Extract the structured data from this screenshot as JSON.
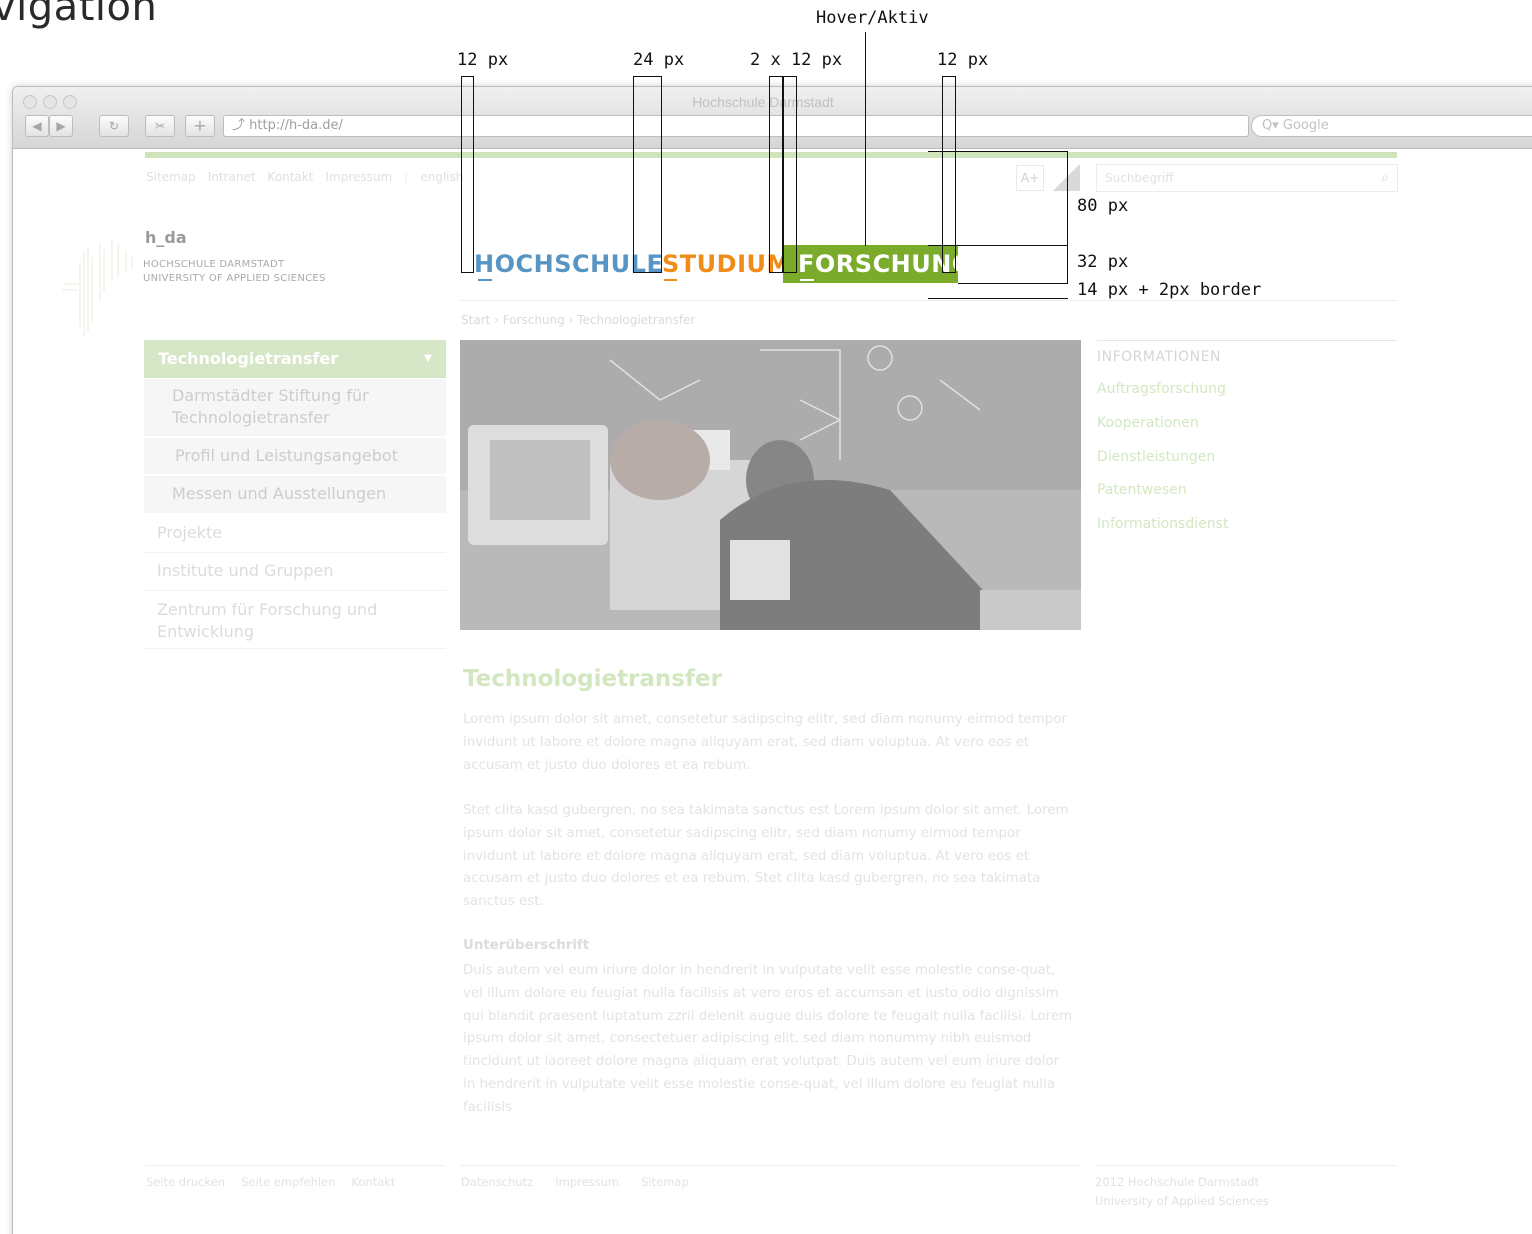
{
  "heading": "vigation",
  "annotations": {
    "hover": "Hover/Aktiv",
    "w12a": "12 px",
    "w24": "24 px",
    "w2x12": "2 x 12 px",
    "w12b": "12 px",
    "h80": "80 px",
    "h32": "32 px",
    "h14": "14 px + 2px border"
  },
  "browser": {
    "title": "Hochschule Darmstadt",
    "url": "http://h-da.de/",
    "search_placeholder": "Google",
    "back_icon": "back-arrow-icon",
    "forward_icon": "forward-arrow-icon",
    "reload_icon": "reload-icon",
    "add_icon": "plus-icon"
  },
  "meta_nav": [
    "Sitemap",
    "Intranet",
    "Kontakt",
    "Impressum",
    "english"
  ],
  "font_size_button": "A+",
  "search": {
    "placeholder": "Suchbegriff"
  },
  "logo": {
    "name": "h_da",
    "line1": "HOCHSCHULE DARMSTADT",
    "line2": "UNIVERSITY OF APPLIED SCIENCES"
  },
  "main_nav": {
    "hochschule": "HOCHSCHULE",
    "studium": "STUDIUM",
    "forschung": "FORSCHUNG",
    "colors": {
      "hochschule": "#5795c5",
      "studium": "#ef8c1a",
      "forschung": "#7bab2b"
    }
  },
  "breadcrumb": "Start › Forschung › Technologietransfer",
  "sidebar": {
    "active": "Technologietransfer",
    "sub": [
      "Darmstädter Stiftung für Technologietransfer",
      "Profil und Leistungsangebot",
      "Messen und Ausstellungen"
    ],
    "items": [
      "Projekte",
      "Institute und Gruppen",
      "Zentrum für Forschung und Entwicklung"
    ]
  },
  "info": {
    "heading": "INFORMATIONEN",
    "links": [
      "Auftragsforschung",
      "Kooperationen",
      "Dienstleistungen",
      "Patentwesen",
      "Informationsdienst"
    ]
  },
  "article": {
    "title": "Technologietransfer",
    "p1": "Lorem ipsum dolor sit amet, consetetur sadipscing elitr, sed diam nonumy eirmod tempor invidunt ut labore et dolore magna aliquyam erat, sed diam voluptua. At vero eos et accusam et justo duo dolores et ea rebum.",
    "p2": "Stet clita kasd gubergren, no sea takimata sanctus est Lorem ipsum dolor sit amet. Lorem ipsum dolor sit amet, consetetur sadipscing elitr, sed diam nonumy eirmod tempor invidunt ut labore et dolore magna aliquyam erat, sed diam voluptua. At vero eos et accusam et justo duo dolores et ea rebum. Stet clita kasd gubergren, no sea takimata sanctus est.",
    "subheading": "Unterüberschrift",
    "p3": "Duis autem vel eum iriure dolor in hendrerit in vulputate velit esse molestie conse-quat, vel illum dolore eu feugiat nulla facilisis at vero eros et accumsan et iusto odio dignissim qui blandit praesent luptatum zzril delenit augue duis dolore te feugait nulla facilisi. Lorem ipsum dolor sit amet, consectetuer adipiscing elit, sed diam nonummy nibh euismod tincidunt ut laoreet dolore magna aliquam erat volutpat. Duis autem vel eum iriure dolor in hendrerit in vulputate velit esse molestie conse-quat, vel illum dolore eu feugiat nulla facilisis"
  },
  "footer": {
    "left": [
      "Seite drucken",
      "Seite empfehlen",
      "Kontakt"
    ],
    "mid": [
      "Datenschutz",
      "Impressum",
      "Sitemap"
    ],
    "right1": "2012 Hochschule Darmstadt",
    "right2": "University of Applied Sciences"
  }
}
